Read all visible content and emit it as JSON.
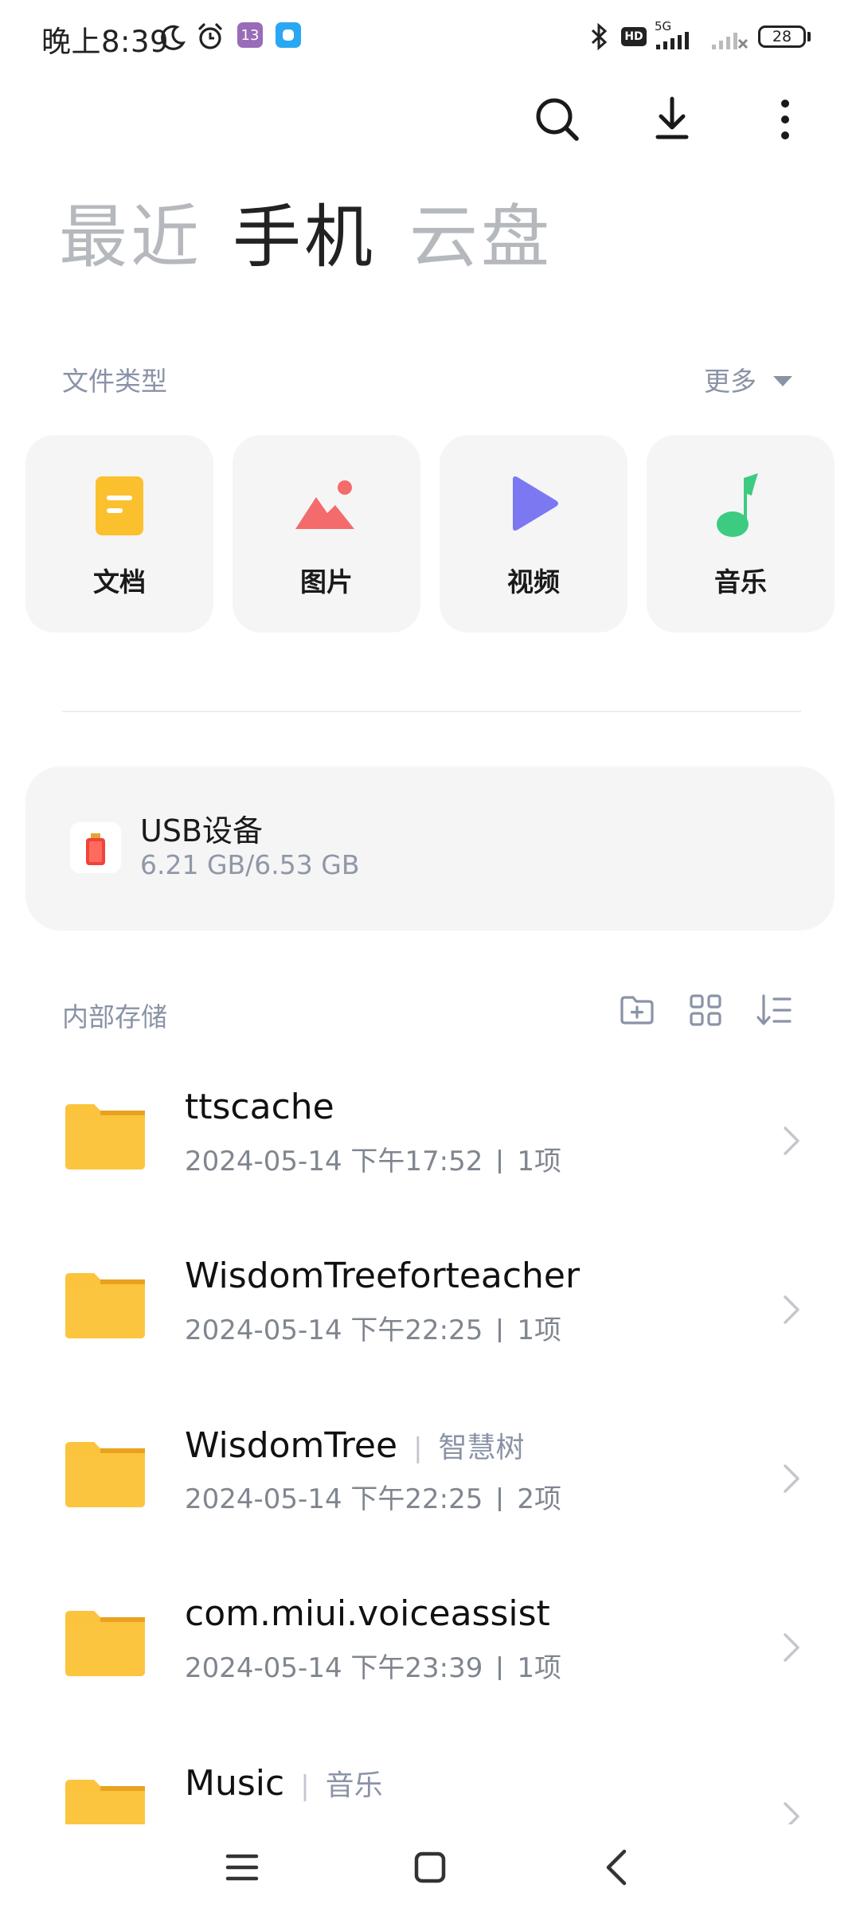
{
  "status_bar": {
    "time": "晚上8:39",
    "badge_1": "13",
    "network": "5G",
    "hd": "HD",
    "battery": "28"
  },
  "toolbar": {
    "icons": [
      "search-icon",
      "download-icon",
      "more-vert-icon"
    ]
  },
  "tabs": [
    {
      "label": "最近",
      "active": false
    },
    {
      "label": "手机",
      "active": true
    },
    {
      "label": "云盘",
      "active": false
    }
  ],
  "file_types": {
    "title": "文件类型",
    "more": "更多",
    "items": [
      {
        "label": "文档",
        "icon": "document-icon",
        "color": "#FBC02D"
      },
      {
        "label": "图片",
        "icon": "image-icon",
        "color": "#F46B6B"
      },
      {
        "label": "视频",
        "icon": "video-play-icon",
        "color": "#7B78F2"
      },
      {
        "label": "音乐",
        "icon": "music-note-icon",
        "color": "#3CCB80"
      }
    ]
  },
  "usb": {
    "name": "USB设备",
    "size": "6.21 GB/6.53 GB"
  },
  "storage": {
    "title": "内部存储",
    "tools": [
      "new-folder-icon",
      "grid-view-icon",
      "sort-icon"
    ]
  },
  "folders": [
    {
      "name": "ttscache",
      "alias": "",
      "date": "2024-05-14 下午17:52",
      "count": "1项"
    },
    {
      "name": "WisdomTreeforteacher",
      "alias": "",
      "date": "2024-05-14 下午22:25",
      "count": "1项"
    },
    {
      "name": "WisdomTree",
      "alias": "智慧树",
      "date": "2024-05-14 下午22:25",
      "count": "2项"
    },
    {
      "name": "com.miui.voiceassist",
      "alias": "",
      "date": "2024-05-14 下午23:39",
      "count": "1项"
    },
    {
      "name": "Music",
      "alias": "音乐",
      "date": "",
      "count": ""
    }
  ],
  "colors": {
    "folder": "#FBC43C",
    "folder_tab": "#E8A21F",
    "secondary_text": "#8A93A6"
  }
}
